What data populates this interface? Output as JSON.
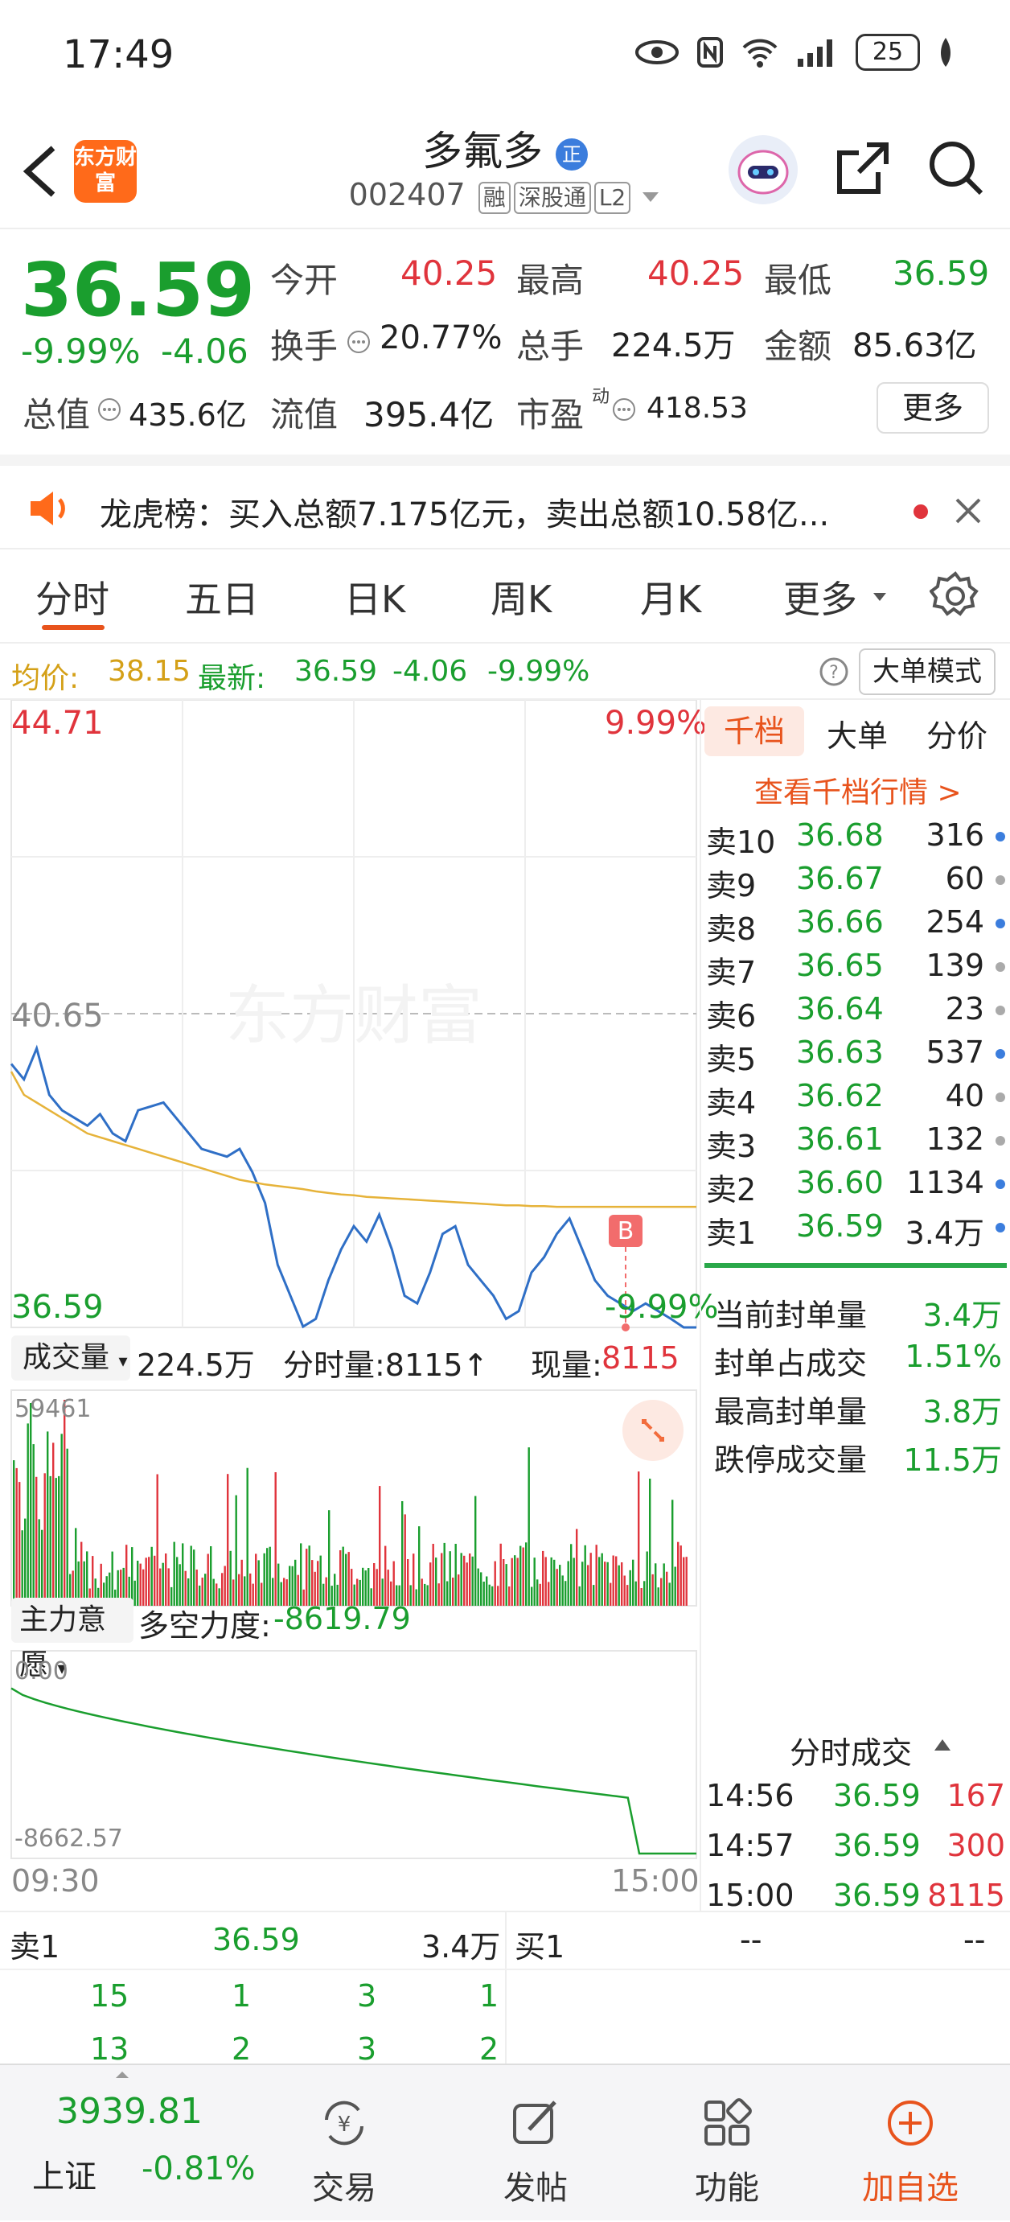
{
  "status_bar": {
    "time": "17:49",
    "battery": "25"
  },
  "header": {
    "logo_text": "东方财富",
    "stock_name": "多氟多",
    "badge": "正",
    "stock_code": "002407",
    "tags": [
      "融",
      "深股通",
      "L2"
    ]
  },
  "quote": {
    "price": "36.59",
    "change_pct": "-9.99%",
    "change": "-4.06",
    "open_label": "今开",
    "open": "40.25",
    "high_label": "最高",
    "high": "40.25",
    "low_label": "最低",
    "low": "36.59",
    "turnover_label": "换手",
    "turnover": "20.77%",
    "volume_label": "总手",
    "volume": "224.5万",
    "amount_label": "金额",
    "amount": "85.63亿",
    "mktcap_label": "总值",
    "mktcap": "435.6亿",
    "float_label": "流值",
    "float_cap": "395.4亿",
    "pe_label": "市盈",
    "pe_sup": "动",
    "pe": "418.53",
    "more_button": "更多"
  },
  "notice": {
    "text": "龙虎榜：买入总额7.175亿元，卖出总额10.58亿..."
  },
  "tabs": {
    "items": [
      "分时",
      "五日",
      "日K",
      "周K",
      "月K",
      "更多"
    ],
    "active": 0
  },
  "avg_line": {
    "avg_label": "均价:",
    "avg": "38.15",
    "latest_label": "最新:",
    "latest": "36.59",
    "latest_change": "-4.06",
    "latest_pct": "-9.99%",
    "big_order_button": "大单模式"
  },
  "chart": {
    "top_price": "44.71",
    "top_pct": "9.99%",
    "mid_price": "40.65",
    "bottom_price": "36.59",
    "bottom_pct": "-9.99%",
    "watermark": "东方财富",
    "b_marker": "B",
    "vol_label": "成交量",
    "vol_total": "224.5万",
    "vol_tick_label": "分时量:8115↑",
    "vol_now_label": "现量:",
    "vol_now": "8115",
    "vol_max": "59461",
    "ind_label": "主力意愿",
    "ind_name_label": "多空力度:",
    "ind_value": "-8619.79",
    "ind_top": "0.00",
    "ind_bottom": "-8662.57",
    "time_start": "09:30",
    "time_end": "15:00"
  },
  "chart_data": {
    "type": "line",
    "x": [
      "09:30",
      "15:00"
    ],
    "series": [
      {
        "name": "最新",
        "values": [
          40.0,
          39.8,
          40.2,
          39.6,
          39.4,
          39.3,
          39.2,
          39.35,
          39.1,
          39.0,
          39.4,
          39.45,
          39.5,
          39.3,
          39.1,
          38.9,
          38.85,
          38.8,
          38.9,
          38.6,
          38.2,
          37.4,
          37.0,
          36.6,
          36.7,
          37.2,
          37.6,
          37.9,
          37.7,
          38.05,
          37.6,
          37.0,
          36.9,
          37.3,
          37.8,
          37.9,
          37.4,
          37.2,
          37.0,
          36.7,
          36.8,
          37.3,
          37.5,
          37.8,
          38.0,
          37.6,
          37.2,
          37.0,
          36.9,
          36.8,
          36.9,
          36.8,
          36.7,
          36.59,
          36.59
        ]
      },
      {
        "name": "均价",
        "values": [
          39.9,
          39.6,
          39.5,
          39.4,
          39.3,
          39.2,
          39.1,
          39.05,
          39.0,
          38.95,
          38.9,
          38.85,
          38.8,
          38.75,
          38.7,
          38.65,
          38.6,
          38.55,
          38.5,
          38.47,
          38.44,
          38.42,
          38.4,
          38.38,
          38.35,
          38.33,
          38.31,
          38.3,
          38.28,
          38.27,
          38.26,
          38.25,
          38.24,
          38.23,
          38.22,
          38.21,
          38.2,
          38.19,
          38.18,
          38.17,
          38.17,
          38.16,
          38.16,
          38.15,
          38.15,
          38.15,
          38.15,
          38.15,
          38.15,
          38.15,
          38.15,
          38.15,
          38.15,
          38.15,
          38.15
        ]
      }
    ],
    "ylim": [
      36.59,
      44.71
    ]
  },
  "orderbook": {
    "tabs": [
      "千档",
      "大单",
      "分价"
    ],
    "link": "查看千档行情 >",
    "asks": [
      {
        "label": "卖10",
        "price": "36.68",
        "vol": "316",
        "dot": "#3b7ddd"
      },
      {
        "label": "卖9",
        "price": "36.67",
        "vol": "60",
        "dot": "#aaaaaa"
      },
      {
        "label": "卖8",
        "price": "36.66",
        "vol": "254",
        "dot": "#3b7ddd"
      },
      {
        "label": "卖7",
        "price": "36.65",
        "vol": "139",
        "dot": "#aaaaaa"
      },
      {
        "label": "卖6",
        "price": "36.64",
        "vol": "23",
        "dot": "#aaaaaa"
      },
      {
        "label": "卖5",
        "price": "36.63",
        "vol": "537",
        "dot": "#3b7ddd"
      },
      {
        "label": "卖4",
        "price": "36.62",
        "vol": "40",
        "dot": "#aaaaaa"
      },
      {
        "label": "卖3",
        "price": "36.61",
        "vol": "132",
        "dot": "#aaaaaa"
      },
      {
        "label": "卖2",
        "price": "36.60",
        "vol": "1134",
        "dot": "#3b7ddd"
      },
      {
        "label": "卖1",
        "price": "36.59",
        "vol": "3.4万",
        "dot": "#3b7ddd"
      }
    ],
    "stats": [
      {
        "label": "当前封单量",
        "value": "3.4万"
      },
      {
        "label": "封单占成交",
        "value": "1.51%"
      },
      {
        "label": "最高封单量",
        "value": "3.8万"
      },
      {
        "label": "跌停成交量",
        "value": "11.5万"
      }
    ],
    "ticks_title": "分时成交",
    "ticks": [
      {
        "time": "14:56",
        "price": "36.59",
        "vol": "167"
      },
      {
        "time": "14:57",
        "price": "36.59",
        "vol": "300"
      },
      {
        "time": "15:00",
        "price": "36.59",
        "vol": "8115"
      }
    ]
  },
  "bottom_table": {
    "sell_label": "卖1",
    "sell_price": "36.59",
    "sell_vol": "3.4万",
    "buy_label": "买1",
    "buy_price": "--",
    "buy_vol": "--",
    "row1": [
      "15",
      "1",
      "3",
      "1"
    ],
    "row2": [
      "13",
      "2",
      "3",
      "2"
    ]
  },
  "bottom_nav": {
    "index_value": "3939.81",
    "index_name": "上证",
    "index_change": "-0.81%",
    "items": [
      "交易",
      "发帖",
      "功能",
      "加自选"
    ]
  }
}
